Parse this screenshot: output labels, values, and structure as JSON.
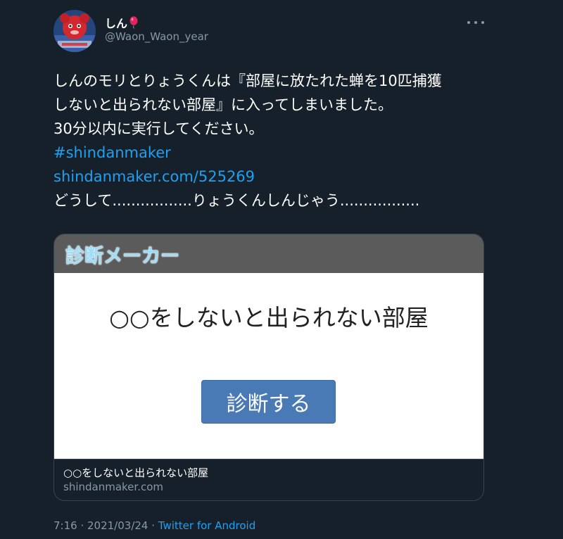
{
  "user": {
    "display_name": "しん",
    "name_emoji_icon": "red-balloon-icon",
    "handle": "@Waon_Waon_year",
    "avatar_icon": "avatar-photo"
  },
  "menu": {
    "icon": "more-options-icon"
  },
  "tweet": {
    "lines": [
      "しんのモリとりょうくんは『部屋に放たれた蝉を10匹捕獲",
      "しないと出られない部屋』に入ってしまいました。",
      "30分以内に実行してください。"
    ],
    "hashtag": "#shindanmaker",
    "link": "shindanmaker.com/525269",
    "last_line": "どうして.................りょうくんしんじゃう................."
  },
  "card": {
    "logo_text": "診断メーカー",
    "image_title": "○○をしないと出られない部屋",
    "button_label": "診断する",
    "title": "○○をしないと出られない部屋",
    "domain": "shindanmaker.com"
  },
  "meta": {
    "time": "7:16",
    "separator1": " · ",
    "date": "2021/03/24",
    "separator2": " · ",
    "source": "Twitter for Android"
  },
  "colors": {
    "background": "#15202b",
    "text": "#ffffff",
    "secondary": "#8899a6",
    "link": "#1da1f2",
    "border": "#38444d",
    "card_header": "#5b5b5b",
    "button": "#4a7ab6"
  }
}
